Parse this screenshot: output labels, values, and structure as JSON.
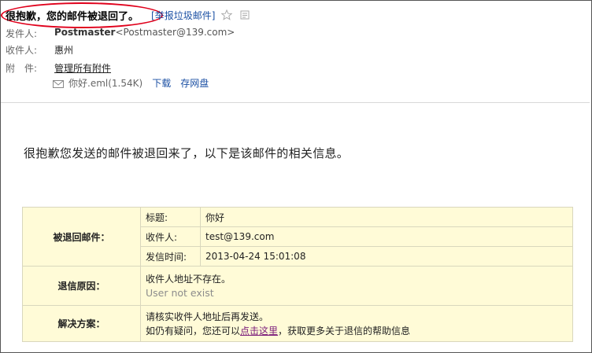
{
  "email": {
    "subject": "很抱歉，您的邮件被退回了。",
    "report_spam": "[举报垃圾邮件]",
    "from_label": "发件人:",
    "from_name": "Postmaster",
    "from_addr": "<Postmaster@139.com>",
    "to_label": "收件人:",
    "to_value": "惠州",
    "attach_label": "附　件:",
    "attach_link": "管理所有附件",
    "file_name": "你好.eml(1.54K)",
    "download": "下载",
    "save_disk": "存网盘"
  },
  "body": {
    "intro": "很抱歉您发送的邮件被退回来了，以下是该邮件的相关信息。",
    "bounced_head": "被退回邮件：",
    "subject_key": "标题:",
    "subject_val": "你好",
    "recipient_key": "收件人:",
    "recipient_val": "test@139.com",
    "time_key": "发信时间:",
    "time_val": "2013-04-24 15:01:08",
    "reason_head": "退信原因：",
    "reason_cn": "收件人地址不存在。",
    "reason_en": "User not exist",
    "solution_head": "解决方案：",
    "solution_line1": "请核实收件人地址后再发送。",
    "solution_prefix": "如仍有疑问，您还可以",
    "solution_link": "点击这里",
    "solution_suffix": "，获取更多关于退信的帮助信息"
  },
  "colors": {
    "highlight_ellipse": "#e0001b",
    "table_bg": "#fffbd7",
    "link": "#1a4fa3"
  }
}
